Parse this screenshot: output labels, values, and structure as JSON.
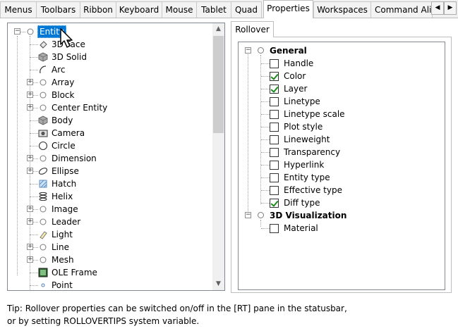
{
  "tabs": [
    "Menus",
    "Toolbars",
    "Ribbon",
    "Keyboard",
    "Mouse",
    "Tablet",
    "Quad",
    "Properties",
    "Workspaces",
    "Command Alias"
  ],
  "active_tab": "Properties",
  "tab_scroll": {
    "left_icon": "arrow-left-icon",
    "right_icon": "arrow-right-icon"
  },
  "entity_tree": {
    "items": [
      {
        "label": "Entity",
        "icon": "circle-icon",
        "expander": "−",
        "selected": true,
        "level": 0
      },
      {
        "label": "3D Face",
        "icon": "3dface-icon",
        "level": 1
      },
      {
        "label": "3D Solid",
        "icon": "3dsolid-icon",
        "level": 1
      },
      {
        "label": "Arc",
        "icon": "arc-icon",
        "level": 1
      },
      {
        "label": "Array",
        "icon": "circle-icon",
        "expander": "+",
        "level": 1
      },
      {
        "label": "Block",
        "icon": "circle-icon",
        "expander": "+",
        "level": 1
      },
      {
        "label": "Center Entity",
        "icon": "circle-icon",
        "expander": "+",
        "level": 1
      },
      {
        "label": "Body",
        "icon": "body-icon",
        "level": 1
      },
      {
        "label": "Camera",
        "icon": "camera-icon",
        "level": 1
      },
      {
        "label": "Circle",
        "icon": "circle-shape-icon",
        "level": 1
      },
      {
        "label": "Dimension",
        "icon": "circle-icon",
        "expander": "+",
        "level": 1
      },
      {
        "label": "Ellipse",
        "icon": "ellipse-icon",
        "expander": "+",
        "level": 1
      },
      {
        "label": "Hatch",
        "icon": "hatch-icon",
        "level": 1
      },
      {
        "label": "Helix",
        "icon": "helix-icon",
        "level": 1
      },
      {
        "label": "Image",
        "icon": "circle-icon",
        "expander": "+",
        "level": 1
      },
      {
        "label": "Leader",
        "icon": "circle-icon",
        "expander": "+",
        "level": 1
      },
      {
        "label": "Light",
        "icon": "light-icon",
        "level": 1
      },
      {
        "label": "Line",
        "icon": "circle-icon",
        "expander": "+",
        "level": 1
      },
      {
        "label": "Mesh",
        "icon": "circle-icon",
        "expander": "+",
        "level": 1
      },
      {
        "label": "OLE Frame",
        "icon": "ole-frame-icon",
        "level": 1
      },
      {
        "label": "Point",
        "icon": "point-icon",
        "level": 1
      }
    ]
  },
  "rollover": {
    "tab_label": "Rollover",
    "groups": [
      {
        "label": "General",
        "items": [
          {
            "label": "Handle",
            "checked": false
          },
          {
            "label": "Color",
            "checked": true
          },
          {
            "label": "Layer",
            "checked": true
          },
          {
            "label": "Linetype",
            "checked": false
          },
          {
            "label": "Linetype scale",
            "checked": false
          },
          {
            "label": "Plot style",
            "checked": false
          },
          {
            "label": "Lineweight",
            "checked": false
          },
          {
            "label": "Transparency",
            "checked": false
          },
          {
            "label": "Hyperlink",
            "checked": false
          },
          {
            "label": "Entity type",
            "checked": false
          },
          {
            "label": "Effective type",
            "checked": false
          },
          {
            "label": "Diff type",
            "checked": true
          }
        ]
      },
      {
        "label": "3D Visualization",
        "items": [
          {
            "label": "Material",
            "checked": false
          }
        ]
      }
    ]
  },
  "tip": {
    "line1": "Tip: Rollover properties can be switched on/off in the [RT] pane in the statusbar,",
    "line2": "or by setting ROLLOVERTIPS system variable."
  },
  "colors": {
    "selection": "#0078d7",
    "check": "#1c8a1c",
    "border": "#828790"
  }
}
